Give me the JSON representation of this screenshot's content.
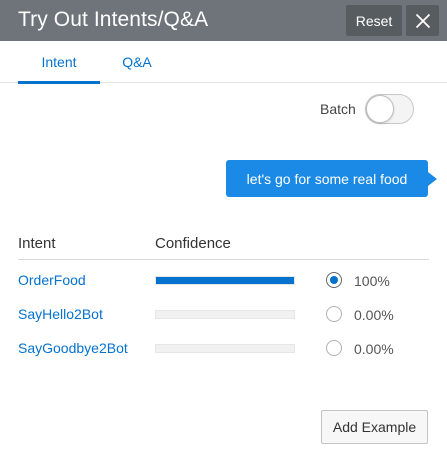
{
  "header": {
    "title": "Try Out Intents/Q&A",
    "reset_label": "Reset",
    "close_icon": "close-icon"
  },
  "tabs": [
    {
      "label": "Intent",
      "active": true
    },
    {
      "label": "Q&A",
      "active": false
    }
  ],
  "batch": {
    "label": "Batch",
    "enabled": false
  },
  "message": {
    "text": "let's go for some real food"
  },
  "results": {
    "columns": {
      "intent": "Intent",
      "confidence": "Confidence"
    },
    "rows": [
      {
        "intent": "OrderFood",
        "confidence": 1.0,
        "confidence_label": "100%",
        "selected": true
      },
      {
        "intent": "SayHello2Bot",
        "confidence": 0.0,
        "confidence_label": "0.00%",
        "selected": false
      },
      {
        "intent": "SayGoodbye2Bot",
        "confidence": 0.0,
        "confidence_label": "0.00%",
        "selected": false
      }
    ]
  },
  "footer": {
    "add_example_label": "Add Example"
  },
  "colors": {
    "header_bg": "#6e7479",
    "accent": "#0572ce",
    "bubble": "#1a8ae6"
  }
}
